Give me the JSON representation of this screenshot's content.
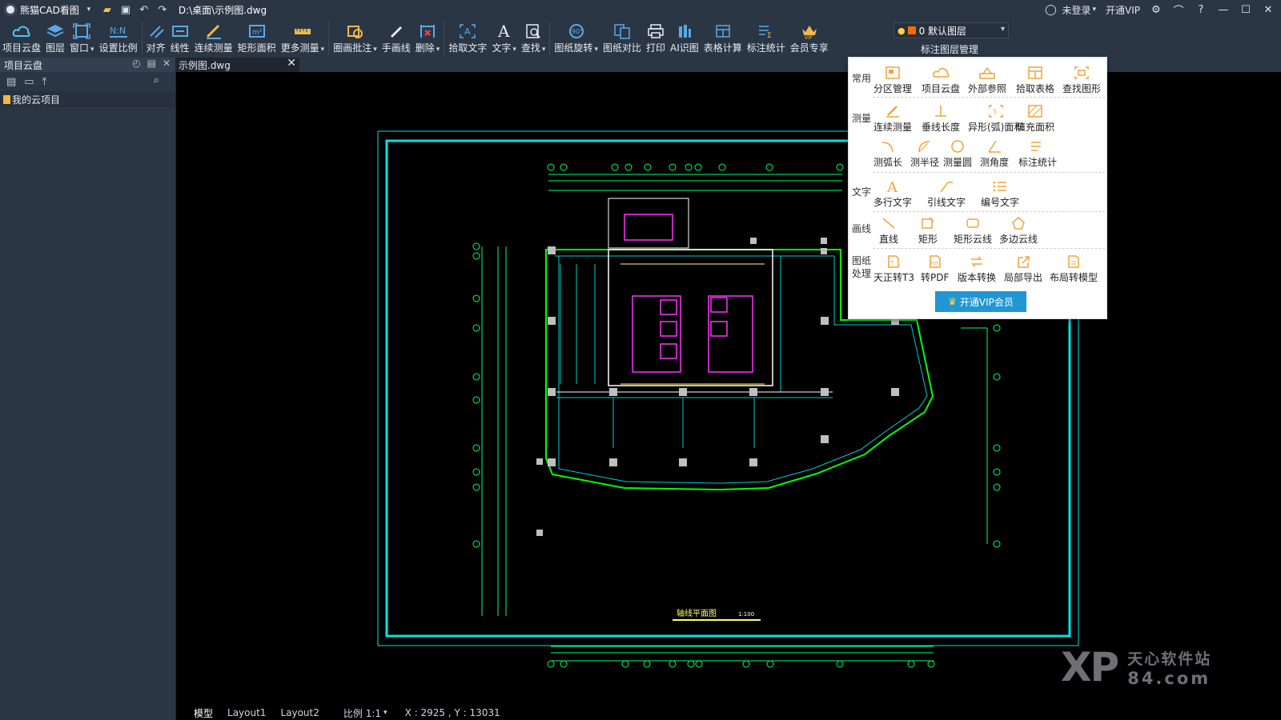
{
  "titlebar": {
    "app_name": "熊猫CAD看图",
    "file_path": "D:\\桌面\\示例图.dwg",
    "login": "未登录",
    "vip": "开通VIP"
  },
  "ribbon": {
    "buttons": [
      {
        "label": "项目云盘",
        "icon": "cloud-drive-icon",
        "dropdown": false
      },
      {
        "label": "图层",
        "icon": "layers-icon",
        "dropdown": false
      },
      {
        "label": "窗口",
        "icon": "window-icon",
        "dropdown": true
      },
      {
        "label": "设置比例",
        "icon": "scale-icon",
        "dropdown": false
      },
      {
        "label": "对齐",
        "icon": "align-icon",
        "dropdown": false
      },
      {
        "label": "线性",
        "icon": "linear-measure-icon",
        "dropdown": false
      },
      {
        "label": "连续测量",
        "icon": "continuous-measure-icon",
        "dropdown": false
      },
      {
        "label": "矩形面积",
        "icon": "rect-area-icon",
        "dropdown": false
      },
      {
        "label": "更多测量",
        "icon": "more-measure-icon",
        "dropdown": true
      },
      {
        "label": "圈画批注",
        "icon": "annotate-icon",
        "dropdown": true
      },
      {
        "label": "手画线",
        "icon": "freehand-icon",
        "dropdown": false
      },
      {
        "label": "删除",
        "icon": "delete-icon",
        "dropdown": true
      },
      {
        "label": "拾取文字",
        "icon": "pick-text-icon",
        "dropdown": false
      },
      {
        "label": "文字",
        "icon": "text-icon",
        "dropdown": true
      },
      {
        "label": "查找",
        "icon": "find-icon",
        "dropdown": true
      },
      {
        "label": "图纸旋转",
        "icon": "rotate-icon",
        "dropdown": true
      },
      {
        "label": "图纸对比",
        "icon": "compare-icon",
        "dropdown": false
      },
      {
        "label": "打印",
        "icon": "print-icon",
        "dropdown": false
      },
      {
        "label": "AI识图",
        "icon": "ai-recognize-icon",
        "dropdown": false
      },
      {
        "label": "表格计算",
        "icon": "table-calc-icon",
        "dropdown": false
      },
      {
        "label": "标注统计",
        "icon": "dim-stats-icon",
        "dropdown": false
      },
      {
        "label": "会员专享",
        "icon": "vip-crown-icon",
        "dropdown": false
      }
    ],
    "layer_select": "0 默认图层",
    "layer_manager": "标注图层管理"
  },
  "left_panel": {
    "title": "项目云盘",
    "tree_item": "我的云项目"
  },
  "doc_tab": {
    "name": "示例图.dwg"
  },
  "menu": {
    "sections": [
      {
        "category": "常用",
        "items": [
          "分区管理",
          "项目云盘",
          "外部参照",
          "拾取表格",
          "查找图形"
        ]
      },
      {
        "category": "测量",
        "items": [
          "连续测量",
          "垂线长度",
          "异形(弧)面积",
          "填充面积",
          "测弧长",
          "测半径",
          "测量圆",
          "测角度",
          "标注统计"
        ]
      },
      {
        "category": "文字",
        "items": [
          "多行文字",
          "引线文字",
          "编号文字"
        ]
      },
      {
        "category": "画线",
        "items": [
          "直线",
          "矩形",
          "矩形云线",
          "多边云线"
        ]
      },
      {
        "category": "图纸处理",
        "items": [
          "天正转T3",
          "转PDF",
          "版本转换",
          "局部导出",
          "布局转模型"
        ]
      }
    ],
    "vip_button": "开通VIP会员"
  },
  "drawing": {
    "title": "轴线平面图",
    "scale_label": "1:100"
  },
  "statusbar": {
    "tabs": [
      "模型",
      "Layout1",
      "Layout2"
    ],
    "scale": "比例 1:1",
    "coords": "X : 2925 , Y : 13031"
  },
  "watermark": {
    "logo": "XP",
    "line1": "天心软件站",
    "line2": "84.com"
  },
  "colors": {
    "frame": "#00e5e5",
    "wall": "#00ff00",
    "accent": "#ff33ff",
    "grid": "#00ff66"
  }
}
